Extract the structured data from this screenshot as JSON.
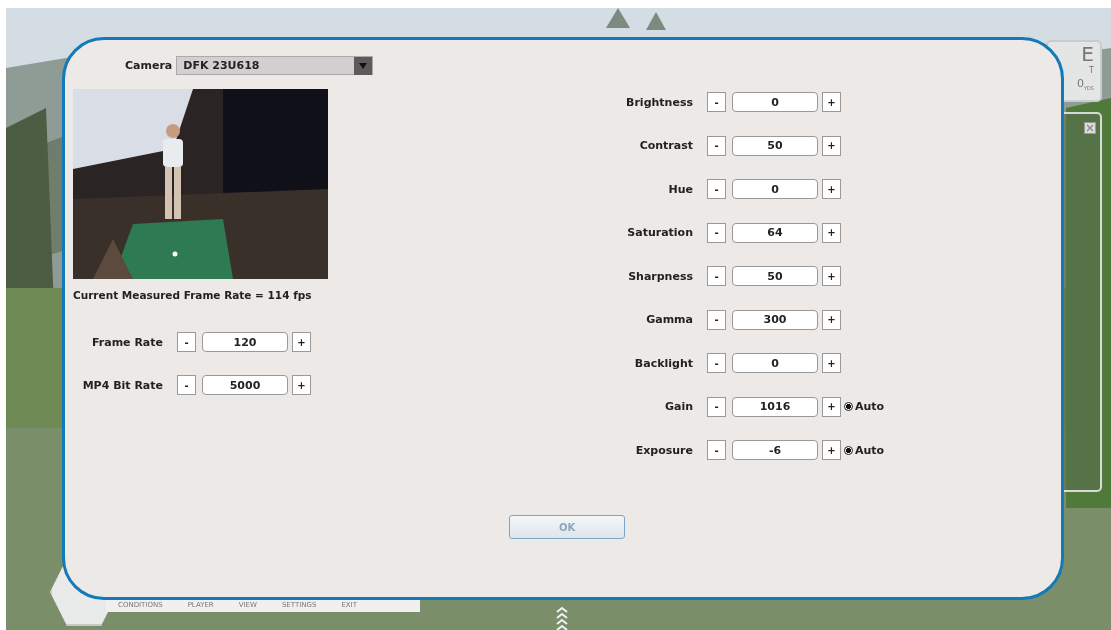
{
  "hud_panel": {
    "texts": [
      "E",
      "T",
      "0$_{YDS}$"
    ]
  },
  "bottom_menu": [
    "CONDITIONS",
    "PLAYER",
    "VIEW",
    "SETTINGS",
    "EXIT"
  ],
  "dialog": {
    "camera": {
      "label": "Camera",
      "value": "DFK 23U618"
    },
    "frame_rate_text": "Current Measured Frame Rate = 114 fps",
    "left_settings": [
      {
        "label": "Frame Rate",
        "value": "120",
        "decrement": "-",
        "increment": "+"
      },
      {
        "label": "MP4 Bit Rate",
        "value": "5000",
        "decrement": "-",
        "increment": "+"
      }
    ],
    "right_settings": [
      {
        "label": "Brightness",
        "value": "0",
        "decrement": "-",
        "increment": "+"
      },
      {
        "label": "Contrast",
        "value": "50",
        "decrement": "-",
        "increment": "+"
      },
      {
        "label": "Hue",
        "value": "0",
        "decrement": "-",
        "increment": "+"
      },
      {
        "label": "Saturation",
        "value": "64",
        "decrement": "-",
        "increment": "+"
      },
      {
        "label": "Sharpness",
        "value": "50",
        "decrement": "-",
        "increment": "+"
      },
      {
        "label": "Gamma",
        "value": "300",
        "decrement": "-",
        "increment": "+"
      },
      {
        "label": "Backlight",
        "value": "0",
        "decrement": "-",
        "increment": "+"
      },
      {
        "label": "Gain",
        "value": "1016",
        "decrement": "-",
        "increment": "+",
        "auto": {
          "label": "Auto",
          "selected": true
        }
      },
      {
        "label": "Exposure",
        "value": "-6",
        "decrement": "-",
        "increment": "+",
        "auto": {
          "label": "Auto",
          "selected": true
        }
      }
    ],
    "ok_button": "OK"
  }
}
